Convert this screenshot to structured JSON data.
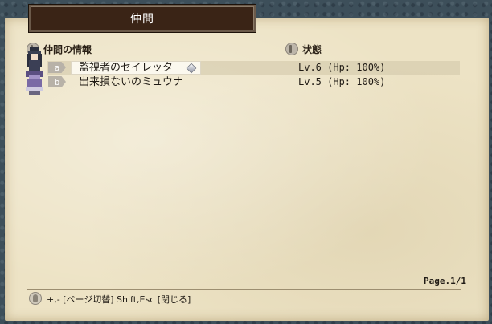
{
  "window": {
    "title": "仲間"
  },
  "headers": {
    "party_info": "仲間の情報",
    "status": "状態"
  },
  "members": [
    {
      "key": "a",
      "name": "監視者のセイレッタ",
      "status": "Lv.6 (Hp: 100%)",
      "selected": true
    },
    {
      "key": "b",
      "name": "出来損ないのミュウナ",
      "status": "Lv.5 (Hp: 100%)",
      "selected": false
    }
  ],
  "page": "Page.1/1",
  "help": "+,- [ページ切替]  Shift,Esc [閉じる]",
  "colors": {
    "title_plate": "#3a2416",
    "parchment": "#ede3c5",
    "text": "#1f1a14",
    "key_badge": "#b8b2a8"
  },
  "icons": {
    "header": "info-icon",
    "cursor": "diamond-cursor-icon",
    "help": "lightbulb-icon"
  }
}
